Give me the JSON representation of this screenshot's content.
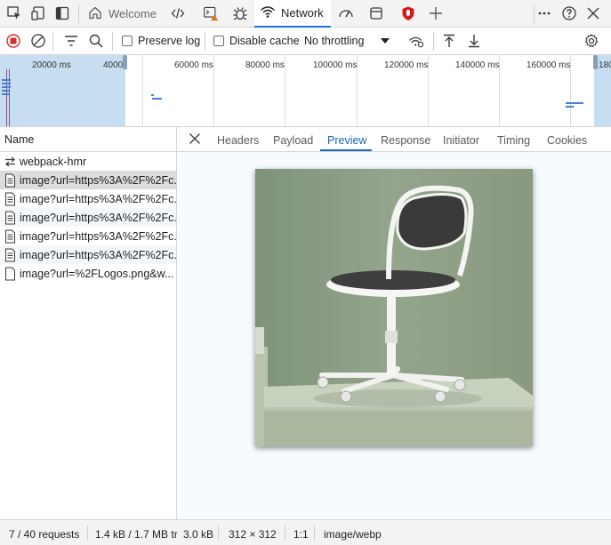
{
  "tabstrip": {
    "tabs": [
      {
        "label": "Welcome",
        "icon": "home-icon"
      },
      {
        "label": "Network",
        "icon": "wifi-icon"
      }
    ],
    "icons": [
      "inspect-icon",
      "device-emulation-icon",
      "dock-icon",
      "elements-icon",
      "console-icon",
      "debugger-icon",
      "performance-icon",
      "application-icon",
      "security-icon",
      "add-tool-icon",
      "more-icon",
      "help-icon",
      "close-icon"
    ],
    "warning_color": "#e8710a",
    "security_color": "#d21b1b"
  },
  "toolbar": {
    "preserve_log": "Preserve log",
    "disable_cache": "Disable cache",
    "throttling": "No throttling",
    "record_color": "#d32f2f"
  },
  "overview": {
    "ticks": [
      "20000 ms",
      "4000",
      "60000 ms",
      "80000 ms",
      "100000 ms",
      "120000 ms",
      "140000 ms",
      "160000 ms",
      "180"
    ]
  },
  "requests": {
    "header": "Name",
    "rows": [
      {
        "name": "webpack-hmr",
        "icon": "websocket-icon"
      },
      {
        "name": "image?url=https%3A%2F%2Fc...",
        "icon": "document-icon"
      },
      {
        "name": "image?url=https%3A%2F%2Fc...",
        "icon": "document-icon"
      },
      {
        "name": "image?url=https%3A%2F%2Fc...",
        "icon": "document-icon"
      },
      {
        "name": "image?url=https%3A%2F%2Fc...",
        "icon": "document-icon"
      },
      {
        "name": "image?url=https%3A%2F%2Fc...",
        "icon": "document-icon"
      },
      {
        "name": "image?url=%2FLogos.png&w...",
        "icon": "document-icon"
      }
    ]
  },
  "detail": {
    "tabs": [
      "Headers",
      "Payload",
      "Preview",
      "Response",
      "Initiator",
      "Timing",
      "Cookies"
    ],
    "active_tab": "Preview",
    "accent": "#1a66b8"
  },
  "status": {
    "requests": "7 / 40 requests",
    "transferred": "1.4 kB / 1.7 MB tr",
    "size": "3.0 kB",
    "dimensions": "312 × 312",
    "ratio": "1:1",
    "mime": "image/webp"
  }
}
